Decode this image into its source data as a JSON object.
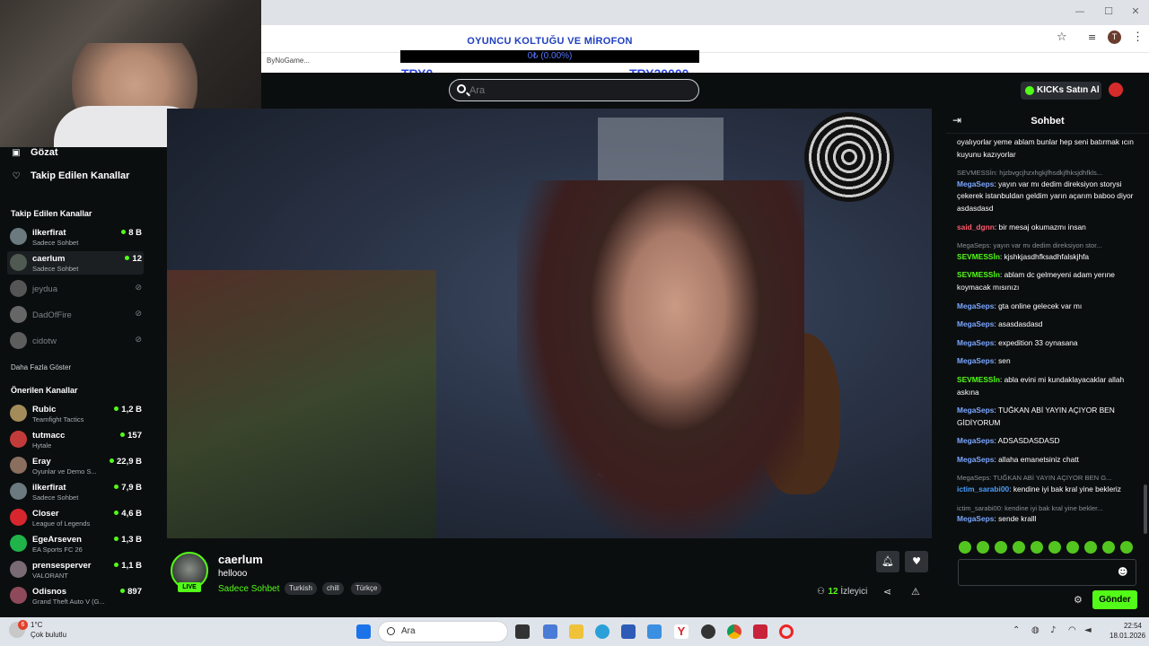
{
  "browser": {
    "bookmark": "ByNoGame...",
    "window_controls": {
      "minimize": "—",
      "maximize": "☐",
      "close": "✕"
    },
    "star_icon": "☆",
    "menu_icon": "⋮",
    "profile_letter": "T"
  },
  "donation": {
    "title": "OYUNCU KOLTUĞU VE MİROFON",
    "progress_text": "0₺ (0.00%)",
    "progress": 0,
    "min_label": "TRY0",
    "max_label": "TRY20000"
  },
  "header": {
    "search_placeholder": "Ara",
    "kicks_button": "KICKs Satın Al"
  },
  "sidebar": {
    "nav": [
      {
        "label": "Gözat",
        "icon": "browse-icon"
      },
      {
        "label": "Takip Edilen Kanallar",
        "icon": "heart-icon"
      }
    ],
    "followed_header": "Takip Edilen Kanallar",
    "followed": [
      {
        "name": "ilkerfirat",
        "category": "Sadece Sohbet",
        "viewers": "8 B",
        "live": true
      },
      {
        "name": "caerlum",
        "category": "Sadece Sohbet",
        "viewers": "12",
        "live": true
      },
      {
        "name": "jeydua",
        "live": false
      },
      {
        "name": "DadOfFire",
        "live": false
      },
      {
        "name": "cidotw",
        "live": false
      }
    ],
    "show_more": "Daha Fazla Göster",
    "recommended_header": "Önerilen Kanallar",
    "recommended": [
      {
        "name": "Rubic",
        "category": "Teamfight Tactics",
        "viewers": "1,2 B"
      },
      {
        "name": "tutmacc",
        "category": "Hytale",
        "viewers": "157"
      },
      {
        "name": "Eray",
        "category": "Oyunlar ve Demo S...",
        "viewers": "22,9 B"
      },
      {
        "name": "ilkerfirat",
        "category": "Sadece Sohbet",
        "viewers": "7,9 B"
      },
      {
        "name": "Closer",
        "category": "League of Legends",
        "viewers": "4,6 B"
      },
      {
        "name": "EgeArseven",
        "category": "EA Sports FC 26",
        "viewers": "1,3 B"
      },
      {
        "name": "prensesperver",
        "category": "VALORANT",
        "viewers": "1,1 B"
      },
      {
        "name": "Odisnos",
        "category": "Grand Theft Auto V (G...",
        "viewers": "897"
      }
    ]
  },
  "stream": {
    "name": "caerlum",
    "title": "hellooo",
    "live_badge": "LIVE",
    "category": "Sadece Sohbet",
    "tags": [
      "Turkish",
      "chill",
      "Türkçe"
    ],
    "viewers_count": "12",
    "viewers_word": "İzleyici"
  },
  "chat": {
    "title": "Sohbet",
    "messages": [
      {
        "user": "",
        "color": "#ffffff",
        "text": "oyalıyorlar yeme ablam bunlar hep seni batırmak ıcın kuyunu kazıyorlar"
      },
      {
        "reply": "SEVMESSİn: hjzbvgcjhzxhgkjfhsdkjfhksjdhfkls...",
        "user": "MegaSeps",
        "color": "#7aa7ff",
        "text": "yayın var mı dedim direksiyon storysi çekerek istanbuldan geldim yarın açarım baboo diyor asdasdasd"
      },
      {
        "user": "said_dgnn",
        "color": "#ff5b6e",
        "text": "bir mesaj okumazmı insan"
      },
      {
        "reply": "MegaSeps: yayın var mı dedim direksiyon stor...",
        "user": "SEVMESSİn",
        "color": "#53fc18",
        "text": "kjshkjasdhfksadhfalskjhfa"
      },
      {
        "user": "SEVMESSİn",
        "color": "#53fc18",
        "text": "ablam dc gelmeyeni adam yerıne koymacak mısınızı"
      },
      {
        "user": "MegaSeps",
        "color": "#7aa7ff",
        "text": "gta online gelecek var mı"
      },
      {
        "user": "MegaSeps",
        "color": "#7aa7ff",
        "text": "asasdasdasd"
      },
      {
        "user": "MegaSeps",
        "color": "#7aa7ff",
        "text": "expedition 33 oynasana"
      },
      {
        "user": "MegaSeps",
        "color": "#7aa7ff",
        "text": "sen"
      },
      {
        "user": "SEVMESSİn",
        "color": "#53fc18",
        "text": "abla evini mi kundaklayacaklar allah askına"
      },
      {
        "user": "MegaSeps",
        "color": "#7aa7ff",
        "text": "TUĞKAN ABİ YAYIN AÇIYOR BEN GİDİYORUM"
      },
      {
        "user": "MegaSeps",
        "color": "#7aa7ff",
        "text": "ADSASDASDASD"
      },
      {
        "user": "MegaSeps",
        "color": "#7aa7ff",
        "text": "allaha emanetsiniz chatt"
      },
      {
        "reply": "MegaSeps: TUĞKAN ABİ YAYIN AÇIYOR BEN G...",
        "user": "ictim_sarabi00",
        "color": "#4a9eff",
        "text": "kendine iyi bak kral yine bekleriz"
      },
      {
        "reply": "ictim_sarabi00: kendine iyi bak kral yine bekler...",
        "user": "MegaSeps",
        "color": "#7aa7ff",
        "text": "sende kralll"
      }
    ],
    "send_button": "Gönder",
    "emote_count": 10
  },
  "taskbar": {
    "search_label": "Ara",
    "weather_temp": "1°C",
    "weather_desc": "Çok bulutlu",
    "time": "22:54",
    "date": "18.01.2026",
    "notification_count": "6"
  },
  "colors": {
    "accent": "#53fc18",
    "bg": "#0b0e0f",
    "donation_blue": "#2a44dd"
  }
}
